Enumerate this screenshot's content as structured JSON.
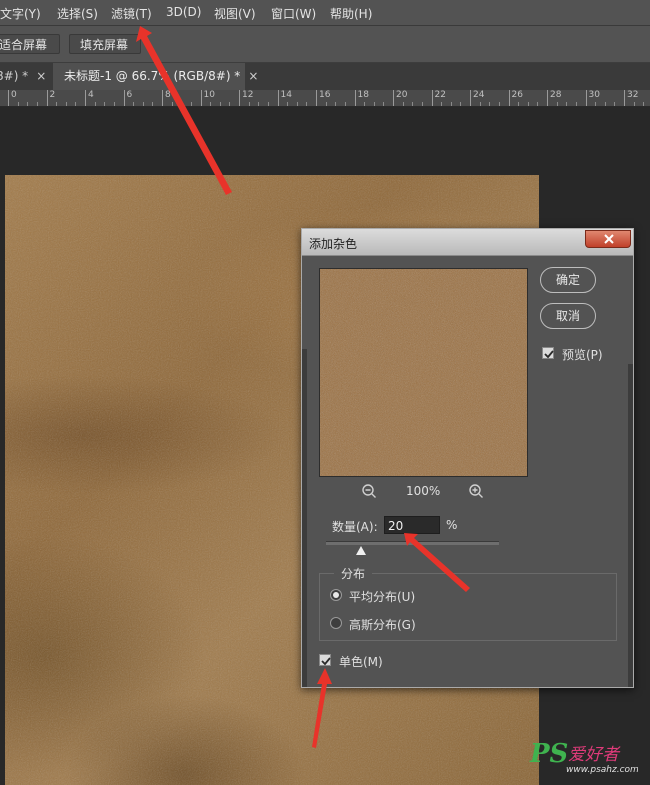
{
  "menu": {
    "items": [
      "文字(Y)",
      "选择(S)",
      "滤镜(T)",
      "3D(D)",
      "视图(V)",
      "窗口(W)",
      "帮助(H)"
    ]
  },
  "options": {
    "fit_screen": "适合屏幕",
    "fill_screen": "填充屏幕"
  },
  "tabs": [
    {
      "label": "8#) *",
      "close": "×"
    },
    {
      "label": "未标题-1 @ 66.7% (RGB/8#) *",
      "close": "×"
    }
  ],
  "ruler": {
    "labels": [
      "0",
      "2",
      "4",
      "6",
      "8",
      "10",
      "12",
      "14",
      "16",
      "18",
      "20",
      "22",
      "24",
      "26",
      "28",
      "30",
      "32"
    ]
  },
  "dialog": {
    "title": "添加杂色",
    "ok_label": "确定",
    "cancel_label": "取消",
    "preview_label": "预览(P)",
    "preview_checked": true,
    "zoom_level": "100%",
    "amount_label": "数量(A):",
    "amount_value": "20",
    "amount_unit": "%",
    "amount_slider_fraction": 0.2,
    "distribution_label": "分布",
    "uniform_label": "平均分布(U)",
    "gaussian_label": "高斯分布(G)",
    "selected_distribution": "uniform",
    "monochrome_label": "单色(M)",
    "monochrome_checked": true
  },
  "watermark": {
    "logo": "PS",
    "text": "爱好者",
    "url": "www.psahz.com"
  },
  "colors": {
    "menubar": "#535353",
    "canvas_brown": "#9a7241",
    "close_button": "#c0402a",
    "annotation_arrow": "#e8332a"
  }
}
